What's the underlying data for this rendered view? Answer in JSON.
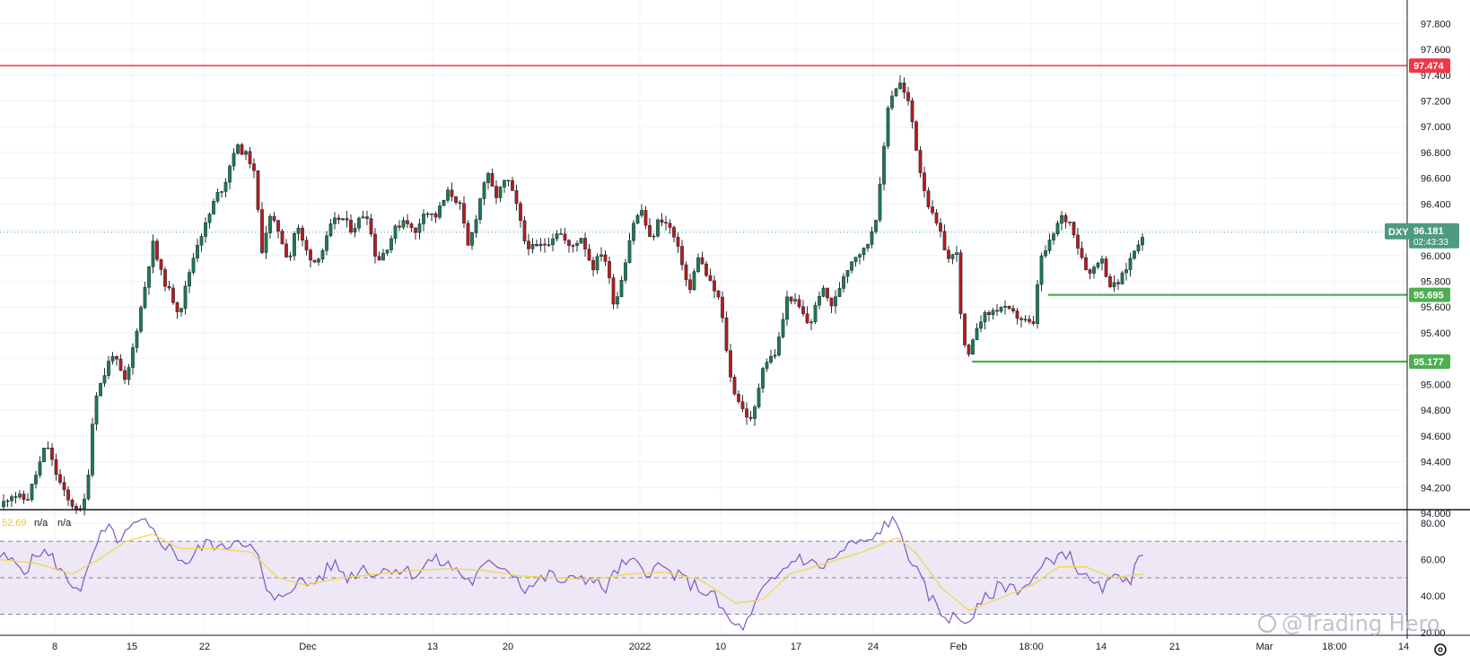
{
  "symbol": "DXY",
  "watermark": "@Trading Hero",
  "colors": {
    "up": "#26a69a",
    "down": "#ef5350",
    "candle_up": "#1b7d4f",
    "candle_down": "#b71c1c",
    "resistance": "#f23645",
    "support": "#4caf50",
    "rsi_line": "#7e57c2",
    "rsi_ma": "#f0d84c",
    "rsi_band": "#ede7f6",
    "grid": "#f0f3fa",
    "current_price": "#26a69a"
  },
  "price_tags": {
    "current_price": "96.181",
    "countdown": "02:43:33",
    "resistance": "97.474",
    "support_1": "95.695",
    "support_2": "95.177"
  },
  "rsi_legend": {
    "value": "52.69",
    "extra_1": "n/a",
    "extra_2": "n/a"
  },
  "chart_data": {
    "type": "candlestick",
    "price_axis": {
      "ticks": [
        "97.800",
        "97.600",
        "97.400",
        "97.200",
        "97.000",
        "96.800",
        "96.600",
        "96.400",
        "96.200",
        "96.000",
        "95.800",
        "95.600",
        "95.400",
        "95.200",
        "95.000",
        "94.800",
        "94.600",
        "94.400",
        "94.200",
        "94.000"
      ],
      "ylim": [
        94.0,
        97.9
      ]
    },
    "rsi_axis": {
      "ticks": [
        "80.00",
        "60.00",
        "40.00",
        "20.00"
      ],
      "ylim": [
        18,
        82
      ],
      "band": [
        30,
        70
      ]
    },
    "time_axis": {
      "labels": [
        "8",
        "15",
        "22",
        "Dec",
        "13",
        "20",
        "2022",
        "10",
        "17",
        "24",
        "Feb",
        "18:00",
        "14",
        "21",
        "Mar",
        "18:00",
        "14"
      ]
    },
    "horizontal_levels": [
      {
        "price": 97.474,
        "style": "resistance"
      },
      {
        "price": 95.695,
        "style": "support",
        "from_label": "14"
      },
      {
        "price": 95.177,
        "style": "support",
        "from_label": "Feb"
      }
    ],
    "price_path": [
      [
        0,
        94.05
      ],
      [
        12,
        94.15
      ],
      [
        30,
        94.1
      ],
      [
        45,
        94.4
      ],
      [
        52,
        94.55
      ],
      [
        60,
        94.35
      ],
      [
        75,
        94.1
      ],
      [
        92,
        94.0
      ],
      [
        100,
        94.4
      ],
      [
        105,
        94.9
      ],
      [
        115,
        95.05
      ],
      [
        125,
        95.25
      ],
      [
        140,
        95.0
      ],
      [
        150,
        95.35
      ],
      [
        160,
        95.7
      ],
      [
        170,
        96.1
      ],
      [
        180,
        95.85
      ],
      [
        190,
        95.7
      ],
      [
        200,
        95.55
      ],
      [
        210,
        95.85
      ],
      [
        220,
        96.1
      ],
      [
        230,
        96.25
      ],
      [
        240,
        96.45
      ],
      [
        250,
        96.55
      ],
      [
        262,
        96.85
      ],
      [
        272,
        96.8
      ],
      [
        282,
        96.7
      ],
      [
        292,
        96.05
      ],
      [
        300,
        96.3
      ],
      [
        310,
        96.2
      ],
      [
        322,
        95.95
      ],
      [
        330,
        96.25
      ],
      [
        340,
        96.05
      ],
      [
        350,
        95.95
      ],
      [
        360,
        96.05
      ],
      [
        370,
        96.25
      ],
      [
        380,
        96.3
      ],
      [
        392,
        96.2
      ],
      [
        408,
        96.35
      ],
      [
        420,
        95.95
      ],
      [
        430,
        96.05
      ],
      [
        440,
        96.2
      ],
      [
        452,
        96.3
      ],
      [
        462,
        96.15
      ],
      [
        472,
        96.35
      ],
      [
        485,
        96.3
      ],
      [
        500,
        96.5
      ],
      [
        512,
        96.4
      ],
      [
        522,
        96.05
      ],
      [
        532,
        96.35
      ],
      [
        542,
        96.65
      ],
      [
        552,
        96.45
      ],
      [
        565,
        96.6
      ],
      [
        575,
        96.4
      ],
      [
        585,
        96.1
      ],
      [
        595,
        96.05
      ],
      [
        610,
        96.1
      ],
      [
        622,
        96.2
      ],
      [
        635,
        96.05
      ],
      [
        648,
        96.15
      ],
      [
        660,
        95.9
      ],
      [
        672,
        96.05
      ],
      [
        685,
        95.6
      ],
      [
        695,
        95.9
      ],
      [
        705,
        96.25
      ],
      [
        715,
        96.35
      ],
      [
        725,
        96.1
      ],
      [
        735,
        96.3
      ],
      [
        748,
        96.2
      ],
      [
        760,
        95.95
      ],
      [
        768,
        95.7
      ],
      [
        778,
        96.0
      ],
      [
        790,
        95.8
      ],
      [
        802,
        95.65
      ],
      [
        815,
        95.0
      ],
      [
        828,
        94.8
      ],
      [
        838,
        94.7
      ],
      [
        850,
        95.15
      ],
      [
        865,
        95.25
      ],
      [
        878,
        95.7
      ],
      [
        890,
        95.6
      ],
      [
        902,
        95.45
      ],
      [
        915,
        95.75
      ],
      [
        928,
        95.6
      ],
      [
        940,
        95.85
      ],
      [
        952,
        96.0
      ],
      [
        965,
        96.05
      ],
      [
        978,
        96.35
      ],
      [
        990,
        97.2
      ],
      [
        1002,
        97.35
      ],
      [
        1014,
        97.15
      ],
      [
        1024,
        96.7
      ],
      [
        1036,
        96.35
      ],
      [
        1046,
        96.2
      ],
      [
        1058,
        95.95
      ],
      [
        1066,
        96.05
      ],
      [
        1072,
        95.35
      ],
      [
        1080,
        95.2
      ],
      [
        1090,
        95.5
      ],
      [
        1102,
        95.55
      ],
      [
        1115,
        95.6
      ],
      [
        1128,
        95.55
      ],
      [
        1140,
        95.5
      ],
      [
        1152,
        95.45
      ],
      [
        1158,
        95.95
      ],
      [
        1170,
        96.1
      ],
      [
        1182,
        96.3
      ],
      [
        1194,
        96.25
      ],
      [
        1202,
        96.05
      ],
      [
        1214,
        95.85
      ],
      [
        1226,
        96.0
      ],
      [
        1238,
        95.75
      ],
      [
        1248,
        95.8
      ],
      [
        1258,
        95.95
      ],
      [
        1268,
        96.1
      ],
      [
        1274,
        96.18
      ]
    ],
    "rsi_path": [
      [
        0,
        62
      ],
      [
        15,
        58
      ],
      [
        30,
        55
      ],
      [
        45,
        65
      ],
      [
        60,
        60
      ],
      [
        75,
        48
      ],
      [
        90,
        45
      ],
      [
        100,
        55
      ],
      [
        110,
        72
      ],
      [
        122,
        76
      ],
      [
        135,
        70
      ],
      [
        148,
        78
      ],
      [
        160,
        80
      ],
      [
        172,
        74
      ],
      [
        185,
        68
      ],
      [
        198,
        62
      ],
      [
        210,
        58
      ],
      [
        222,
        66
      ],
      [
        235,
        70
      ],
      [
        248,
        65
      ],
      [
        262,
        72
      ],
      [
        275,
        70
      ],
      [
        288,
        60
      ],
      [
        296,
        44
      ],
      [
        306,
        36
      ],
      [
        318,
        42
      ],
      [
        330,
        48
      ],
      [
        345,
        46
      ],
      [
        360,
        52
      ],
      [
        372,
        58
      ],
      [
        388,
        50
      ],
      [
        405,
        56
      ],
      [
        420,
        52
      ],
      [
        435,
        56
      ],
      [
        450,
        54
      ],
      [
        465,
        52
      ],
      [
        480,
        60
      ],
      [
        495,
        58
      ],
      [
        510,
        54
      ],
      [
        525,
        47
      ],
      [
        540,
        56
      ],
      [
        555,
        58
      ],
      [
        570,
        54
      ],
      [
        585,
        44
      ],
      [
        600,
        48
      ],
      [
        615,
        52
      ],
      [
        630,
        46
      ],
      [
        645,
        52
      ],
      [
        660,
        48
      ],
      [
        675,
        44
      ],
      [
        690,
        56
      ],
      [
        705,
        58
      ],
      [
        720,
        54
      ],
      [
        735,
        56
      ],
      [
        750,
        52
      ],
      [
        765,
        48
      ],
      [
        780,
        44
      ],
      [
        795,
        40
      ],
      [
        810,
        28
      ],
      [
        822,
        22
      ],
      [
        835,
        26
      ],
      [
        848,
        42
      ],
      [
        862,
        48
      ],
      [
        876,
        56
      ],
      [
        890,
        62
      ],
      [
        902,
        58
      ],
      [
        915,
        56
      ],
      [
        928,
        60
      ],
      [
        942,
        66
      ],
      [
        956,
        70
      ],
      [
        968,
        68
      ],
      [
        980,
        76
      ],
      [
        992,
        82
      ],
      [
        1004,
        74
      ],
      [
        1015,
        60
      ],
      [
        1026,
        48
      ],
      [
        1038,
        38
      ],
      [
        1050,
        30
      ],
      [
        1062,
        28
      ],
      [
        1074,
        26
      ],
      [
        1086,
        30
      ],
      [
        1098,
        38
      ],
      [
        1110,
        44
      ],
      [
        1122,
        46
      ],
      [
        1136,
        44
      ],
      [
        1150,
        48
      ],
      [
        1162,
        56
      ],
      [
        1176,
        62
      ],
      [
        1188,
        64
      ],
      [
        1200,
        56
      ],
      [
        1212,
        48
      ],
      [
        1224,
        44
      ],
      [
        1236,
        46
      ],
      [
        1248,
        52
      ],
      [
        1260,
        50
      ],
      [
        1268,
        58
      ],
      [
        1274,
        60
      ]
    ],
    "rsi_ma_path": [
      [
        0,
        60
      ],
      [
        40,
        58
      ],
      [
        80,
        52
      ],
      [
        110,
        60
      ],
      [
        140,
        70
      ],
      [
        170,
        74
      ],
      [
        200,
        66
      ],
      [
        240,
        66
      ],
      [
        280,
        64
      ],
      [
        310,
        50
      ],
      [
        340,
        46
      ],
      [
        380,
        50
      ],
      [
        420,
        52
      ],
      [
        460,
        54
      ],
      [
        500,
        55
      ],
      [
        540,
        54
      ],
      [
        580,
        51
      ],
      [
        620,
        50
      ],
      [
        660,
        49
      ],
      [
        700,
        52
      ],
      [
        740,
        53
      ],
      [
        780,
        49
      ],
      [
        820,
        36
      ],
      [
        850,
        38
      ],
      [
        880,
        52
      ],
      [
        920,
        58
      ],
      [
        960,
        64
      ],
      [
        1000,
        72
      ],
      [
        1020,
        64
      ],
      [
        1050,
        44
      ],
      [
        1080,
        32
      ],
      [
        1110,
        38
      ],
      [
        1150,
        46
      ],
      [
        1180,
        56
      ],
      [
        1210,
        56
      ],
      [
        1240,
        50
      ],
      [
        1274,
        52
      ]
    ]
  }
}
